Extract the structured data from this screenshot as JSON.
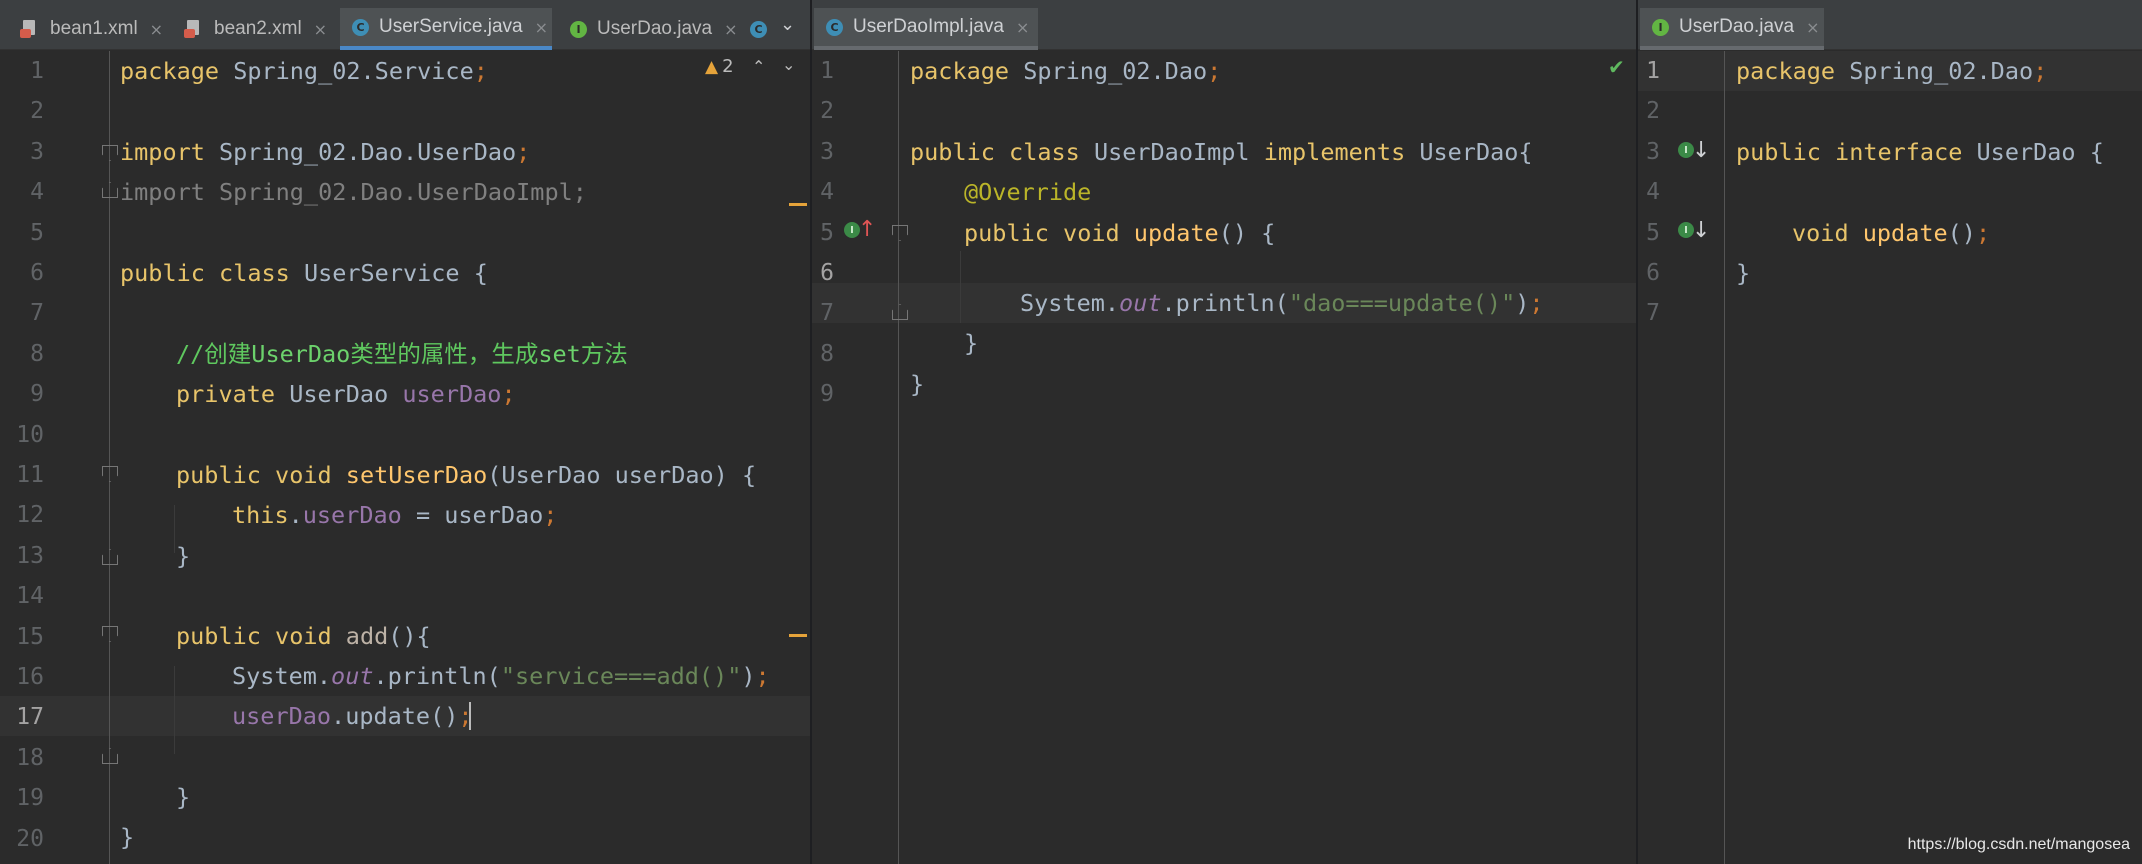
{
  "left_pane": {
    "tabs": [
      {
        "label": "bean1.xml",
        "icon": "xml-file-icon",
        "close": "×"
      },
      {
        "label": "bean2.xml",
        "icon": "xml-file-icon",
        "close": "×"
      },
      {
        "label": "UserService.java",
        "icon": "class-icon",
        "icon_letter": "C",
        "close": "×",
        "active": true
      },
      {
        "label": "UserDao.java",
        "icon": "interface-icon",
        "icon_letter": "I",
        "close": "×"
      },
      {
        "label": "",
        "icon": "class-icon",
        "icon_letter": "C"
      }
    ],
    "more_tabs": "⌄",
    "warning_count": "2",
    "line_numbers": [
      "1",
      "2",
      "3",
      "4",
      "5",
      "6",
      "7",
      "8",
      "9",
      "10",
      "11",
      "12",
      "13",
      "14",
      "15",
      "16",
      "17",
      "18",
      "19",
      "20"
    ],
    "current_line": "17"
  },
  "mid_pane": {
    "tabs": [
      {
        "label": "UserDaoImpl.java",
        "icon": "class-icon",
        "icon_letter": "C",
        "close": "×",
        "active": true
      }
    ],
    "line_numbers": [
      "1",
      "2",
      "3",
      "4",
      "5",
      "6",
      "7",
      "8",
      "9"
    ],
    "current_line": "6"
  },
  "right_pane": {
    "tabs": [
      {
        "label": "UserDao.java",
        "icon": "interface-icon",
        "icon_letter": "I",
        "close": "×",
        "active": true
      }
    ],
    "line_numbers": [
      "1",
      "2",
      "3",
      "4",
      "5",
      "6",
      "7"
    ],
    "current_line": "1"
  },
  "code": {
    "left": {
      "l1": [
        "package",
        " Spring_02.Service",
        ";"
      ],
      "l3": [
        "import",
        " Spring_02.Dao.UserDao",
        ";"
      ],
      "l4": "import Spring_02.Dao.UserDaoImpl;",
      "l6": [
        "public",
        " ",
        "class",
        " UserService {"
      ],
      "l8": [
        "//创建",
        "UserDao",
        "类型的属性，生成",
        "set",
        "方法"
      ],
      "l9": [
        "private",
        " UserDao ",
        "userDao",
        ";"
      ],
      "l11": [
        "public",
        " ",
        "void",
        " ",
        "setUserDao",
        "(UserDao userDao) {"
      ],
      "l12": [
        "this",
        ".",
        "userDao",
        " = userDao",
        ";"
      ],
      "l13": "}",
      "l15": [
        "public",
        " ",
        "void",
        " ",
        "add",
        "(){"
      ],
      "l16": [
        "System.",
        "out",
        ".println(",
        "\"service===add()\"",
        ")",
        ";"
      ],
      "l17": [
        "userDao",
        ".update()",
        ";"
      ],
      "l18": "}",
      "l19": "}"
    },
    "mid": {
      "l1": [
        "package",
        " Spring_02.Dao",
        ";"
      ],
      "l3": [
        "public",
        " ",
        "class",
        " UserDaoImpl ",
        "implements",
        " UserDao{"
      ],
      "l4": "@Override",
      "l5": [
        "public",
        " ",
        "void",
        " ",
        "update",
        "() {"
      ],
      "l6": [
        "System.",
        "out",
        ".println(",
        "\"dao===update()\"",
        ")",
        ";"
      ],
      "l7": "}",
      "l8": "}"
    },
    "right": {
      "l1": [
        "package",
        " Spring_02.Dao",
        ";"
      ],
      "l3": [
        "public",
        " ",
        "interface",
        " UserDao {"
      ],
      "l5": [
        "void",
        " ",
        "update",
        "()",
        ";"
      ],
      "l6": "}"
    }
  },
  "watermark": "https://blog.csdn.net/mangosea",
  "colors": {
    "background": "#2b2b2b",
    "keyword": "#cc7832",
    "string": "#6a8759",
    "field": "#9876aa",
    "method": "#ffc66d",
    "annotation": "#bbb529",
    "comment": "#5fc85f",
    "accent": "#4a88c7"
  }
}
